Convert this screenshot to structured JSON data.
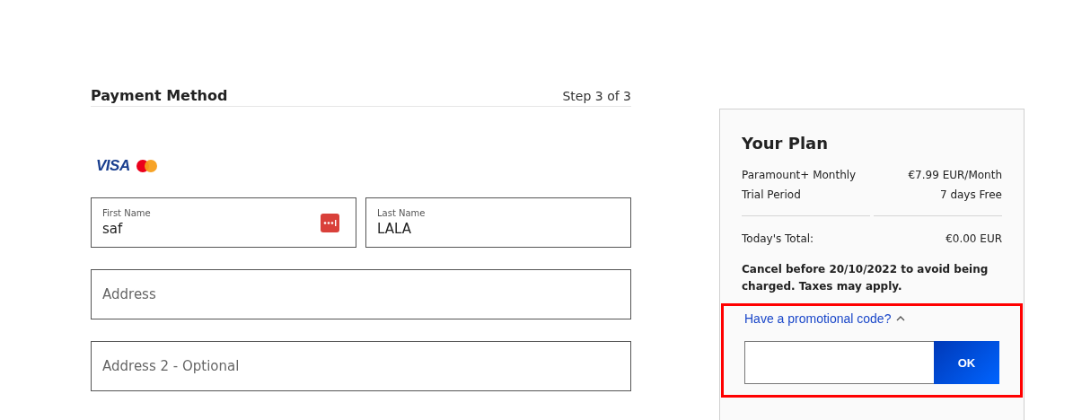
{
  "payment": {
    "title": "Payment Method",
    "step": "Step 3 of 3",
    "card_brands": [
      {
        "kind": "visa",
        "label": "VISA"
      },
      {
        "kind": "mastercard"
      }
    ],
    "name_fields": [
      {
        "label": "First Name",
        "value": "saf",
        "autofill_icon": true
      },
      {
        "label": "Last Name",
        "value": "LALA",
        "autofill_icon": false
      }
    ],
    "address_fields": [
      {
        "placeholder": "Address"
      },
      {
        "placeholder": "Address 2 - Optional"
      }
    ]
  },
  "plan": {
    "title": "Your Plan",
    "lines": [
      {
        "label": "Paramount+ Monthly",
        "value": "€7.99 EUR/Month"
      },
      {
        "label": "Trial Period",
        "value": "7 days Free"
      }
    ],
    "total": {
      "label": "Today's Total:",
      "value": "€0.00 EUR"
    },
    "notice": "Cancel before 20/10/2022 to avoid being charged. Taxes may apply.",
    "promo": {
      "link": "Have a promotional code?",
      "expanded": true,
      "highlighted": true,
      "button": "OK"
    }
  }
}
